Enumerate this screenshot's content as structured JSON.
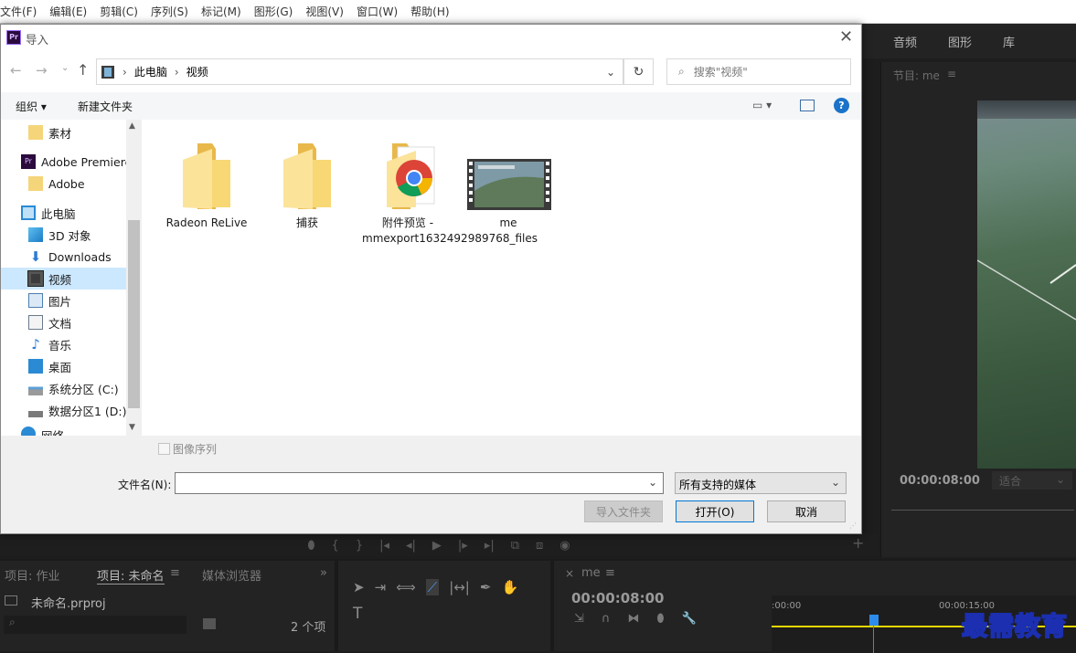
{
  "menu": [
    "文件(F)",
    "编辑(E)",
    "剪辑(C)",
    "序列(S)",
    "标记(M)",
    "图形(G)",
    "视图(V)",
    "窗口(W)",
    "帮助(H)"
  ],
  "premiere": {
    "workspaces": [
      "音频",
      "图形",
      "库"
    ],
    "program_title": "节目: me",
    "program_timecode": "00:00:08:00",
    "fit_label": "适合",
    "panels": {
      "project_tab1": "项目: 作业",
      "project_tab2": "项目: 未命名",
      "media_browser": "媒体浏览器",
      "project_file": "未命名.prproj",
      "item_count": "2 个项",
      "sequence_tab": "me",
      "seq_timecode": "00:00:08:00",
      "ruler_start": ":00:00",
      "ruler_mid": "00:00:15:00"
    },
    "accent_color": "#2d8ceb"
  },
  "dialog": {
    "title": "导入",
    "breadcrumb": [
      "此电脑",
      "视频"
    ],
    "search_placeholder": "搜索\"视频\"",
    "toolbar": {
      "organize": "组织",
      "new_folder": "新建文件夹"
    },
    "sidebar": [
      {
        "label": "素材",
        "icon": "folder-icon"
      },
      {
        "label": "Adobe Premiere",
        "icon": "premiere-icon"
      },
      {
        "label": "Adobe",
        "icon": "folder-icon"
      },
      {
        "label": "此电脑",
        "icon": "computer-icon"
      },
      {
        "label": "3D 对象",
        "icon": "3d-objects-icon"
      },
      {
        "label": "Downloads",
        "icon": "downloads-icon"
      },
      {
        "label": "视频",
        "icon": "video-icon",
        "selected": true
      },
      {
        "label": "图片",
        "icon": "pictures-icon"
      },
      {
        "label": "文档",
        "icon": "documents-icon"
      },
      {
        "label": "音乐",
        "icon": "music-icon"
      },
      {
        "label": "桌面",
        "icon": "desktop-icon"
      },
      {
        "label": "系统分区 (C:)",
        "icon": "drive-c-icon"
      },
      {
        "label": "数据分区1 (D:)",
        "icon": "drive-d-icon"
      },
      {
        "label": "网络",
        "icon": "network-icon"
      }
    ],
    "files": [
      {
        "label": "Radeon ReLive",
        "icon": "folder-icon"
      },
      {
        "label": "捕获",
        "icon": "folder-icon"
      },
      {
        "label": "附件预览 - mmexport1632492989768_files",
        "icon": "chrome-folder-icon"
      },
      {
        "label": "me",
        "icon": "video-thumbnail-icon"
      }
    ],
    "image_sequence_label": "图像序列",
    "filename_label": "文件名(N):",
    "filename_value": "",
    "filetype_value": "所有支持的媒体",
    "buttons": {
      "import_folder": "导入文件夹",
      "open": "打开(O)",
      "cancel": "取消"
    }
  },
  "watermark": "最需教育"
}
